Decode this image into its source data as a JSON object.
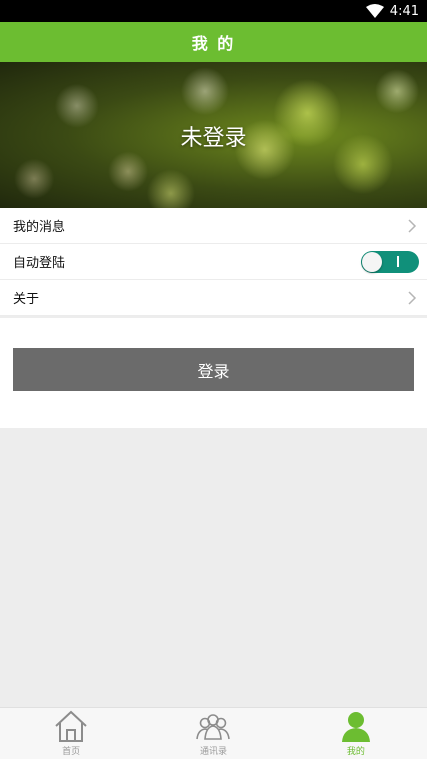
{
  "status_bar": {
    "time": "4:41"
  },
  "header": {
    "title": "我 的"
  },
  "hero": {
    "title": "未登录"
  },
  "menu": {
    "items": [
      {
        "label": "我的消息"
      },
      {
        "label": "自动登陆",
        "toggle_on": true
      },
      {
        "label": "关于"
      }
    ]
  },
  "login": {
    "button_label": "登录"
  },
  "tabbar": {
    "tabs": [
      {
        "label": "首页",
        "icon": "home-icon",
        "active": false
      },
      {
        "label": "通讯录",
        "icon": "contacts-icon",
        "active": false
      },
      {
        "label": "我的",
        "icon": "person-icon",
        "active": true
      }
    ]
  },
  "colors": {
    "accent": "#6cbd31",
    "toggle": "#10907a",
    "button": "#6b6b6b"
  }
}
